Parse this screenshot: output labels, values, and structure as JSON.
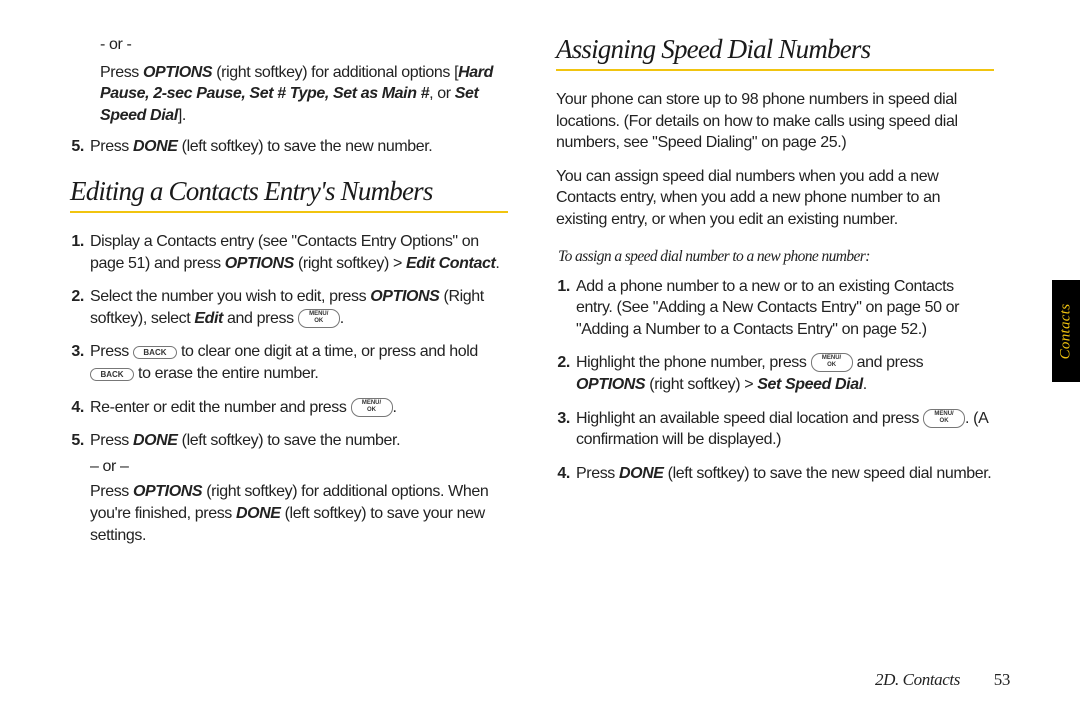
{
  "sidetab": "Contacts",
  "footer": {
    "section": "2D. Contacts",
    "page": "53"
  },
  "left": {
    "top_or": "- or -",
    "top_line1a": "Press ",
    "top_options": "OPTIONS",
    "top_line1b": " (right softkey) for additional options [",
    "top_hard": "Hard Pause, 2-sec Pause, Set # Type, Set as Main #",
    "top_or2": ", or ",
    "top_setspeed": "Set Speed Dial",
    "top_line1c": "].",
    "step5a": "Press ",
    "step5_done": "DONE",
    "step5b": " (left softkey) to save the new number.",
    "heading": "Editing a Contacts Entry's Numbers",
    "s1a": "Display a Contacts entry (see \"Contacts Entry Options\" on page 51) and press ",
    "s1_opt": "OPTIONS",
    "s1b": " (right softkey) > ",
    "s1_edit": "Edit Contact",
    "s1c": ".",
    "s2a": "Select the number you wish to edit, press ",
    "s2_opt": "OPTIONS",
    "s2b": " (Right softkey), select ",
    "s2_edit": "Edit",
    "s2c": " and press ",
    "s3a": "Press ",
    "s3b": " to clear one digit at a time, or press and hold ",
    "s3c": " to erase the entire number.",
    "s4a": "Re-enter or edit the number and press ",
    "s5a": "Press ",
    "s5_done": "DONE",
    "s5b": " (left softkey) to save the number.",
    "s5_or": "– or –",
    "s5c": "Press ",
    "s5_opt": "OPTIONS",
    "s5d": " (right softkey) for additional options. When you're finished, press ",
    "s5_done2": "DONE",
    "s5e": " (left softkey) to save your new settings."
  },
  "right": {
    "heading": "Assigning Speed Dial Numbers",
    "p1": "Your phone can store up to 98 phone numbers in speed dial locations. (For details on how to make calls using speed dial numbers, see \"Speed Dialing\" on page 25.)",
    "p2": "You can assign speed dial numbers when you add a new Contacts entry, when you add a new phone number to an existing entry, or when you edit an existing number.",
    "sub": "To assign a speed dial number to a new phone number:",
    "r1": "Add a phone number to a new or to an existing Contacts entry. (See \"Adding a New Contacts Entry\" on page 50 or \"Adding a Number to a Contacts Entry\" on page 52.)",
    "r2a": "Highlight the phone number, press ",
    "r2b": " and press ",
    "r2_opt": "OPTIONS",
    "r2c": " (right softkey) > ",
    "r2_set": "Set Speed Dial",
    "r2d": ".",
    "r3a": "Highlight an available speed dial location and press ",
    "r3b": ". (A confirmation will be displayed.)",
    "r4a": "Press ",
    "r4_done": "DONE",
    "r4b": " (left softkey) to save the new speed dial number."
  },
  "keys": {
    "back": "BACK",
    "menu1": "MENU/",
    "menu2": "OK"
  }
}
